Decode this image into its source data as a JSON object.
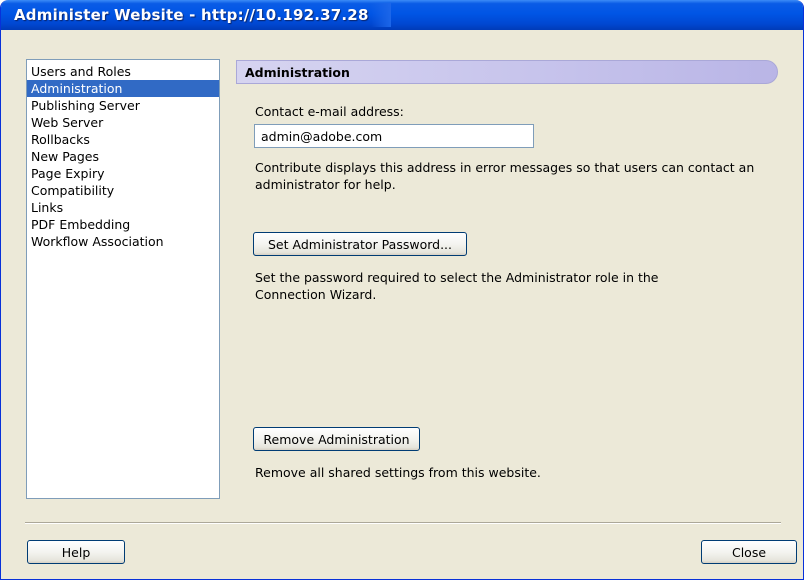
{
  "window": {
    "title": "Administer Website - http://10.192.37.28"
  },
  "sidebar": {
    "items": [
      {
        "label": "Users and Roles",
        "selected": false
      },
      {
        "label": "Administration",
        "selected": true
      },
      {
        "label": "Publishing Server",
        "selected": false
      },
      {
        "label": "Web Server",
        "selected": false
      },
      {
        "label": "Rollbacks",
        "selected": false
      },
      {
        "label": "New Pages",
        "selected": false
      },
      {
        "label": "Page Expiry",
        "selected": false
      },
      {
        "label": "Compatibility",
        "selected": false
      },
      {
        "label": "Links",
        "selected": false
      },
      {
        "label": "PDF Embedding",
        "selected": false
      },
      {
        "label": "Workflow Association",
        "selected": false
      }
    ]
  },
  "main": {
    "section_title": "Administration",
    "contact_label": "Contact e-mail address:",
    "contact_value": "admin@adobe.com",
    "contact_description": "Contribute displays this address in error messages so that users can contact an administrator for help.",
    "set_password_label": "Set Administrator Password...",
    "password_description": "Set the password required to select the Administrator role in the Connection Wizard.",
    "remove_label": "Remove Administration",
    "remove_description": "Remove all shared settings from this website."
  },
  "footer": {
    "help_label": "Help",
    "close_label": "Close"
  },
  "colors": {
    "titlebar": "#0055e5",
    "dialog_bg": "#ece9d8",
    "selection": "#316ac5",
    "section_header": "#c7c4ec"
  }
}
